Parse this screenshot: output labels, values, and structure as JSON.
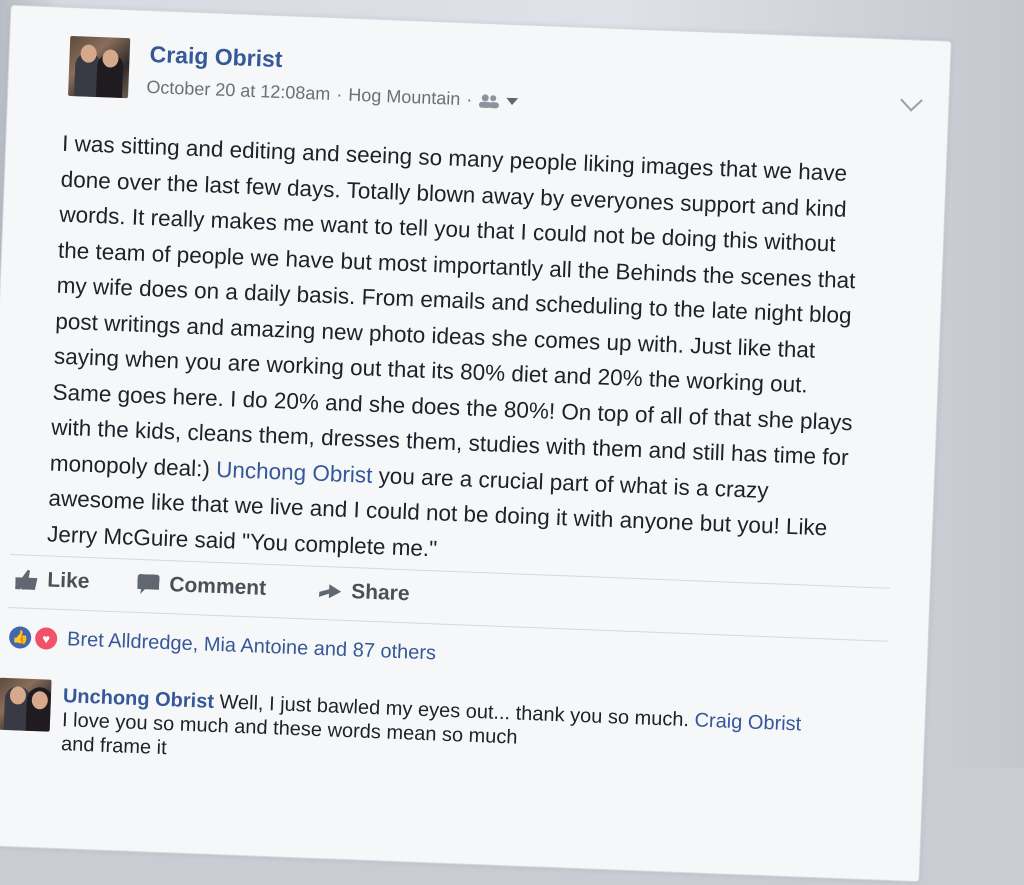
{
  "post": {
    "author": "Craig Obrist",
    "time": "October 20 at 12:08am",
    "location": "Hog Mountain",
    "separator": " · ",
    "text_lines": [
      "I was sitting and editing and seeing so many people liking images that we have",
      "done over the last few days. Totally blown away by everyones support and kind",
      "words. It really makes me want to tell you that I could not be doing this without",
      "the team of people we have but most importantly all the Behinds the scenes that",
      "my wife does on a daily basis. From emails and scheduling to the late night blog",
      "post writings and amazing new photo ideas she comes up with. Just like that",
      "saying when you are working out that its 80% diet and 20% the working out.",
      "Same goes here. I do 20% and she does the 80%! On top of all of that she plays",
      "with the kids, cleans them, dresses them, studies with them and still has time for"
    ],
    "line10_before": "monopoly deal:) ",
    "line10_mention": "Unchong Obrist",
    "line10_after": " you are a crucial part of what is a crazy",
    "line11": "awesome like that we live and I could not be doing it with anyone but you! Like",
    "line12": "Jerry McGuire said \"You complete me.\""
  },
  "actions": {
    "like": "Like",
    "comment": "Comment",
    "share": "Share"
  },
  "reactions": {
    "summary": "Bret Alldredge, Mia Antoine and 87 others"
  },
  "comment": {
    "author": "Unchong Obrist",
    "line1_text": " Well, I just bawled my eyes out... thank you so much. ",
    "line1_mention": "Craig Obrist",
    "line2": "I love you so much and these words mean so much",
    "line3": "and frame it"
  },
  "colors": {
    "link": "#365899",
    "text": "#1d2129",
    "meta": "#6b6f78"
  },
  "icons": [
    "audience-friends-icon",
    "dropdown-caret-icon",
    "chevron-down-icon",
    "like-icon",
    "comment-icon",
    "share-icon",
    "like-reaction-icon",
    "love-reaction-icon"
  ]
}
